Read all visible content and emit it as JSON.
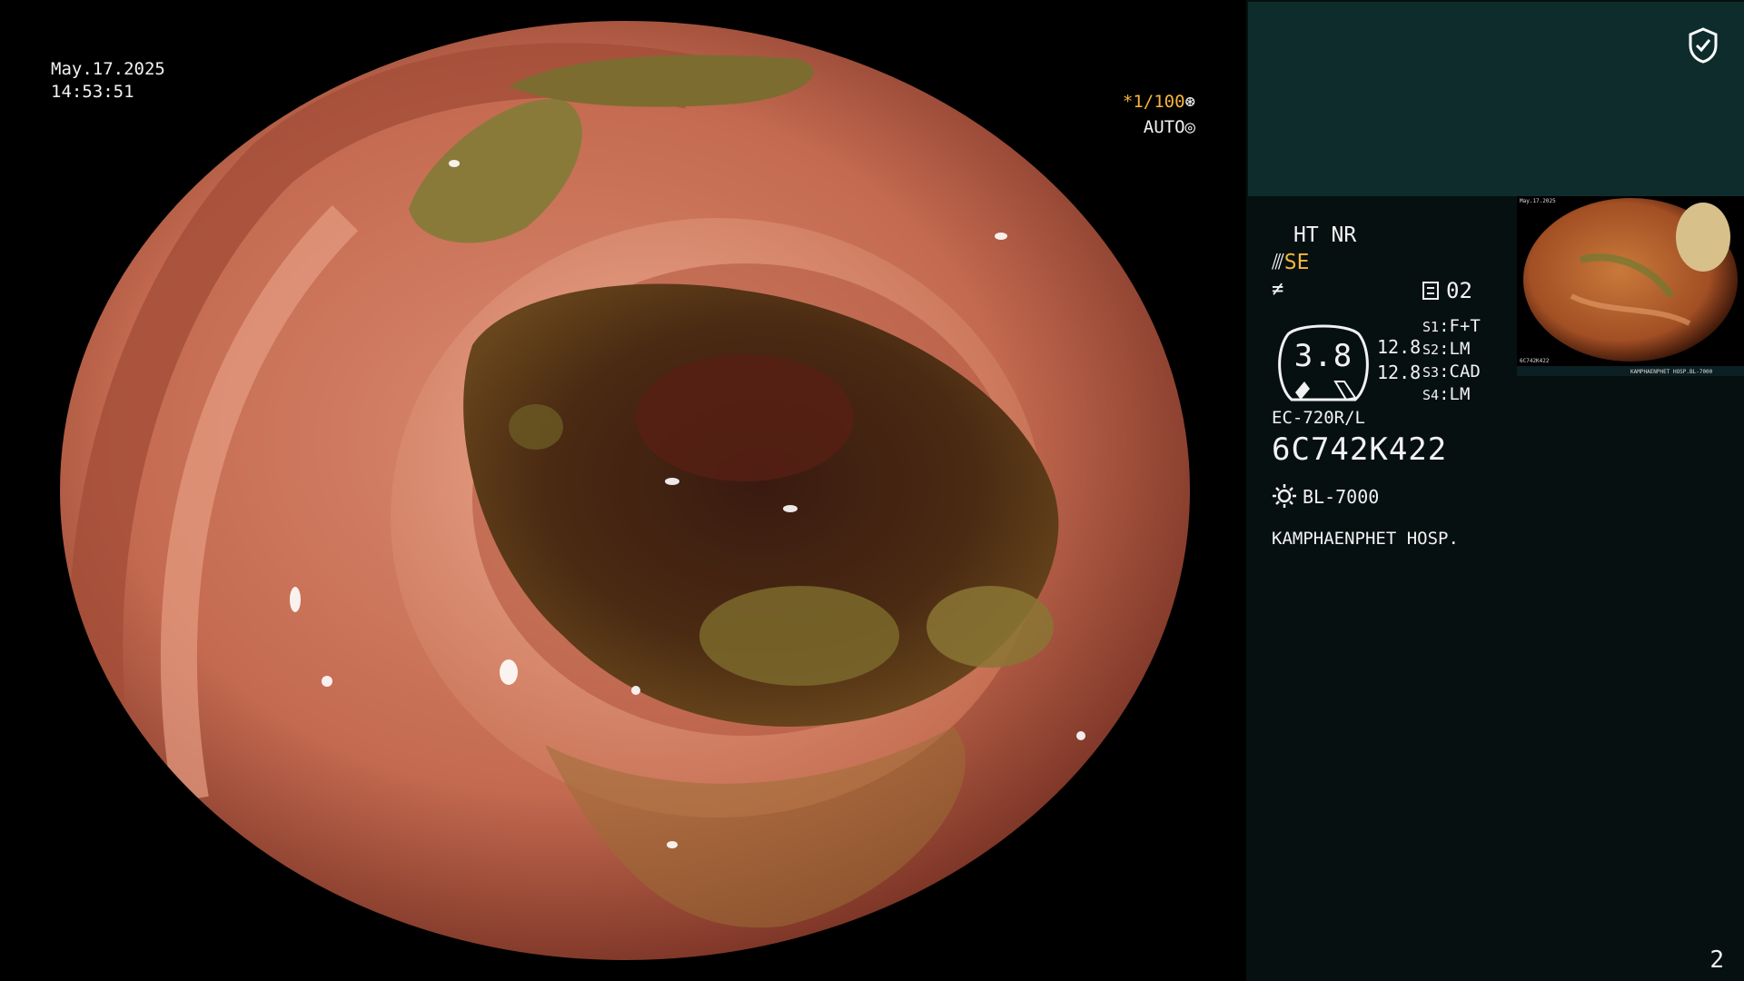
{
  "overlay": {
    "date": "May.17.2025",
    "time": "14:53:51",
    "shutter": "*1/100",
    "exposure": "AUTO"
  },
  "panel": {
    "mode": "HT NR",
    "enhance": "SE",
    "memory": "02",
    "gauge_value": "3.8",
    "brightness_1": "12.8",
    "brightness_2": "12.8",
    "switches": [
      {
        "label": "S1",
        "value": "F+T"
      },
      {
        "label": "S2",
        "value": "LM"
      },
      {
        "label": "S3",
        "value": "CAD"
      },
      {
        "label": "S4",
        "value": "LM"
      }
    ],
    "scope_model": "EC-720R/L",
    "serial": "6C742K422",
    "light_source": "BL-7000",
    "hospital": "KAMPHAENPHET HOSP.",
    "page": "2"
  },
  "thumbnail": {
    "date": "May.17.2025",
    "serial": "6C742K422",
    "hospital": "KAMPHAENPHET HOSP.",
    "light_source": "BL-7000"
  },
  "icons": [
    "shield-check-icon",
    "shutter-icon",
    "iris-icon",
    "scope-tip-icon",
    "freeze-icon",
    "memory-icon",
    "gauge-icon",
    "light-source-icon"
  ],
  "colors": {
    "accent": "#f5b63d",
    "panel_bg": "#071011",
    "panel_top": "#0f2c2c"
  }
}
